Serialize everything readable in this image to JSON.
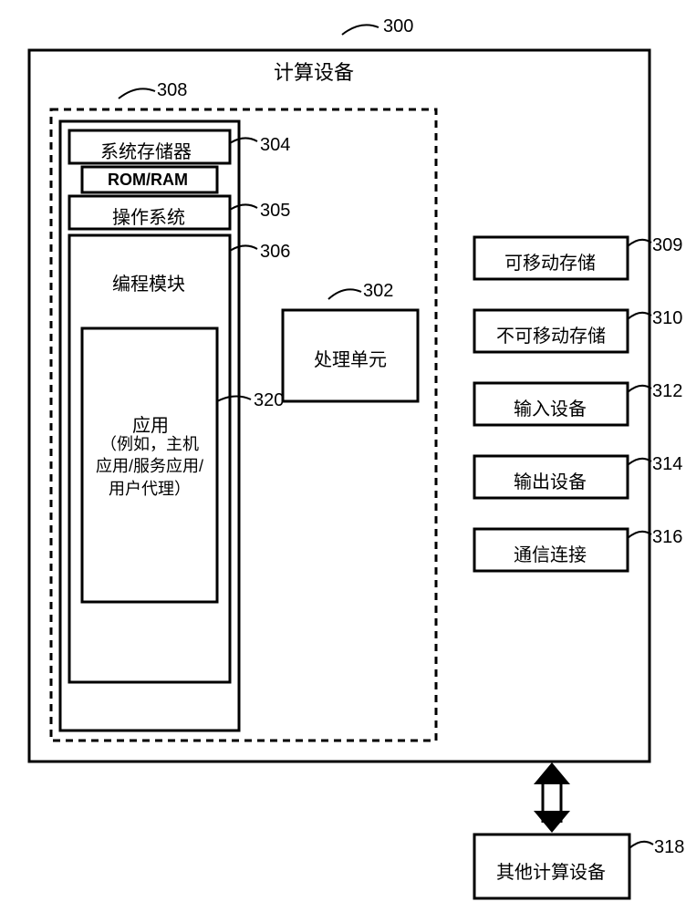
{
  "diagram": {
    "title_ref": "300",
    "title": "计算设备",
    "subsystem_ref": "308",
    "blocks": {
      "system_memory": {
        "label": "系统存储器",
        "ref": "304"
      },
      "rom_ram": {
        "label": "ROM/RAM"
      },
      "os": {
        "label": "操作系统",
        "ref": "305"
      },
      "prog_module": {
        "label": "编程模块",
        "ref": "306"
      },
      "application": {
        "label": "应用",
        "sub": "（例如，主机\n应用/服务应用/\n用户代理）",
        "ref": "320"
      },
      "processing_unit": {
        "label": "处理单元",
        "ref": "302"
      },
      "removable_storage": {
        "label": "可移动存储",
        "ref": "309"
      },
      "nonremovable_storage": {
        "label": "不可移动存储",
        "ref": "310"
      },
      "input_device": {
        "label": "输入设备",
        "ref": "312"
      },
      "output_device": {
        "label": "输出设备",
        "ref": "314"
      },
      "comm_conn": {
        "label": "通信连接",
        "ref": "316"
      },
      "other_devices": {
        "label": "其他计算设备",
        "ref": "318"
      }
    }
  }
}
